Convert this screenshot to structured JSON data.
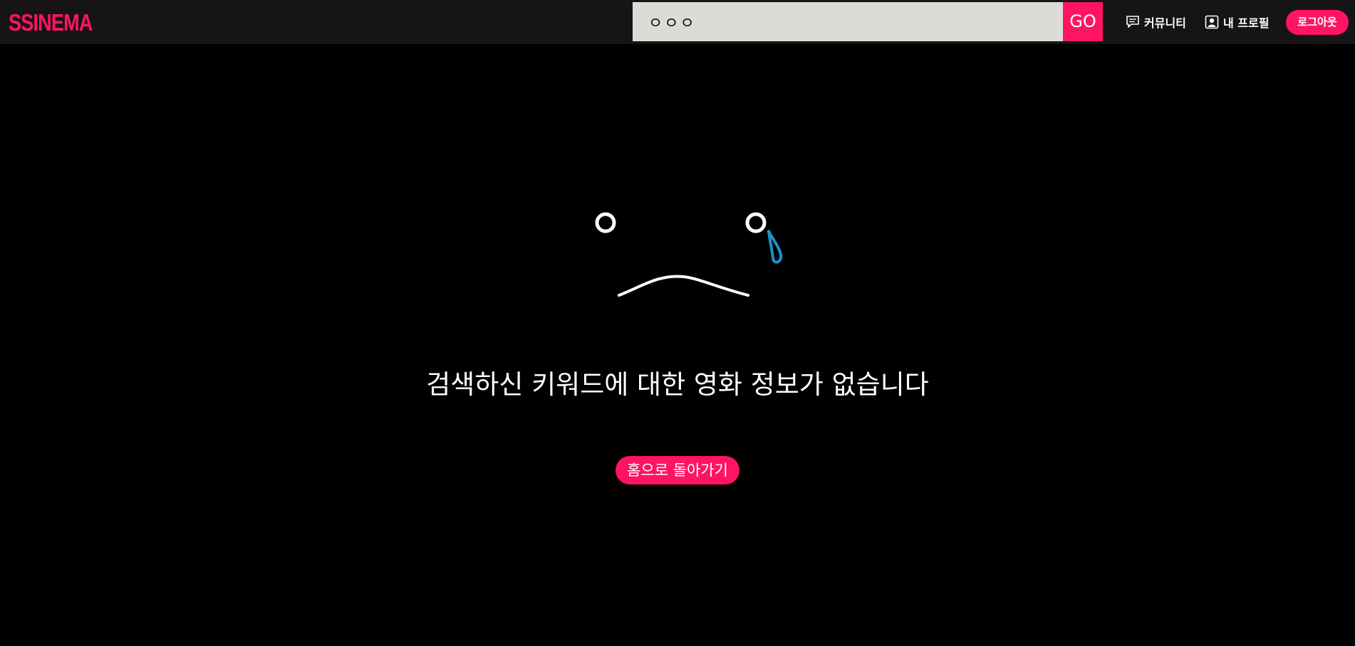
{
  "header": {
    "logo": "SSINEMA",
    "search": {
      "value": "ㅇㅇㅇ",
      "go_label": "GO"
    },
    "nav": {
      "community_label": "커뮤니티",
      "profile_label": "내 프로필",
      "logout_label": "로그아웃"
    }
  },
  "main": {
    "message": "검색하신 키워드에 대한 영화 정보가 없습니다",
    "home_button_label": "홈으로 돌아가기"
  },
  "colors": {
    "accent": "#ff1464",
    "header_bg": "#161415",
    "page_bg": "#000000",
    "search_bg": "#dcdcd6",
    "tear": "#1e90c8"
  },
  "icons": {
    "community": "chat-bubble-icon",
    "profile": "person-icon",
    "illustration": "sad-face-icon"
  }
}
